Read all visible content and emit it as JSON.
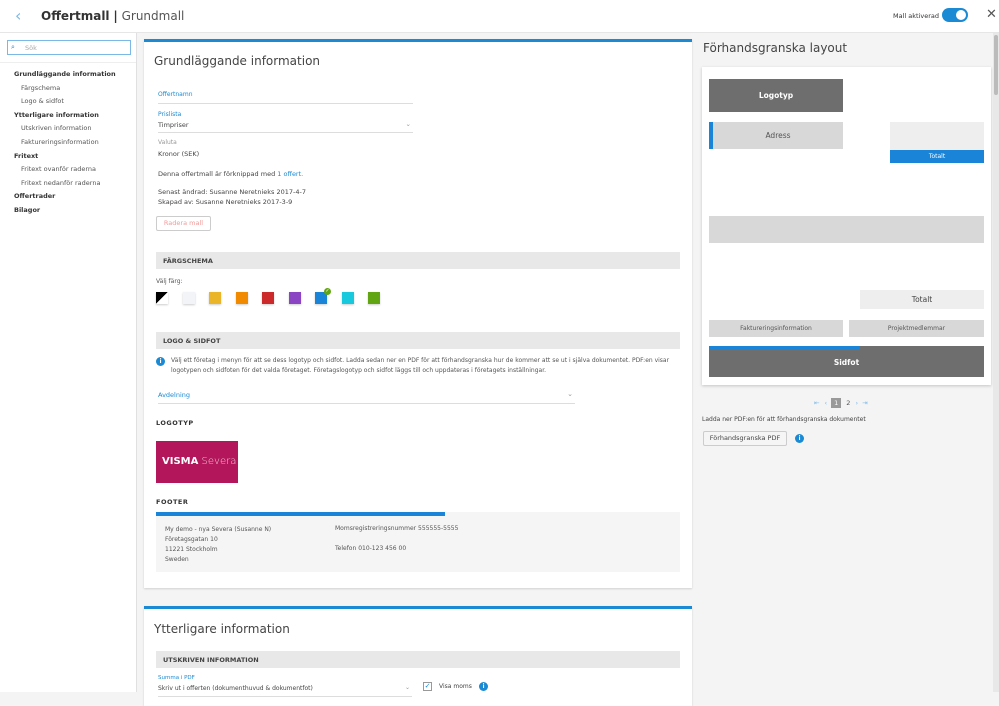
{
  "header": {
    "title_bold": "Offertmall",
    "separator": "|",
    "title_light": "Grundmall",
    "toggle_label": "Mall aktiverad",
    "toggle_on": true
  },
  "sidebar": {
    "search_placeholder": "Sök",
    "items": [
      {
        "label": "Grundläggande information",
        "level": "top"
      },
      {
        "label": "Färgschema",
        "level": "sub"
      },
      {
        "label": "Logo & sidfot",
        "level": "sub"
      },
      {
        "label": "Ytterligare information",
        "level": "top"
      },
      {
        "label": "Utskriven information",
        "level": "sub"
      },
      {
        "label": "Faktureringsinformation",
        "level": "sub"
      },
      {
        "label": "Fritext",
        "level": "top"
      },
      {
        "label": "Fritext ovanför raderna",
        "level": "sub"
      },
      {
        "label": "Fritext nedanför raderna",
        "level": "sub"
      },
      {
        "label": "Offertrader",
        "level": "top"
      },
      {
        "label": "Bilagor",
        "level": "top"
      }
    ]
  },
  "basic": {
    "title": "Grundläggande information",
    "name_label": "Offertnamn",
    "pricelist_label": "Prislista",
    "pricelist_value": "Timpriser",
    "currency_label": "Valuta",
    "currency_value": "Kronor (SEK)",
    "linked_prefix": "Denna offertmall är förknippad med",
    "linked_link": "1 offert.",
    "modified": "Senast ändrad: Susanne Neretnieks 2017-4-7",
    "created": "Skapad av: Susanne Neretnieks 2017-3-9",
    "delete_button": "Radera mall"
  },
  "colors": {
    "section": "FÄRGSCHEMA",
    "choose_label": "Välj färg:",
    "swatches": [
      "#000000",
      "#f2f4f7",
      "#eab528",
      "#f28a00",
      "#cc2a2a",
      "#8b44c4",
      "#1a84d8",
      "#18c8dc",
      "#62a512"
    ],
    "selected_index": 6
  },
  "logo": {
    "section": "LOGO & SIDFOT",
    "info": "Välj ett företag i menyn för att se dess logotyp och sidfot. Ladda sedan ner en PDF för att förhandsgranska hur de kommer att se ut i själva dokumentet. PDF:en visar logotypen och sidfoten för det valda företaget. Företagslogotyp och sidfot läggs till och uppdateras i företagets inställningar.",
    "department_label": "Avdelning",
    "logotype_heading": "LOGOTYP",
    "logo_text_bold": "VISMA",
    "logo_text_light": "Severa",
    "logo_bg": "#b3165a",
    "footer_heading": "FOOTER",
    "footer_left": [
      "My demo - nya Severa (Susanne N)",
      "Företagsgatan 10",
      "11221 Stockholm",
      "Sweden"
    ],
    "footer_vat": "Momsregistreringsnummer 555555-5555",
    "footer_phone": "Telefon 010-123 456 00"
  },
  "additional": {
    "title": "Ytterligare information",
    "section": "UTSKRIVEN INFORMATION",
    "sum_label": "Summa i PDF",
    "sum_value": "Skriv ut i offerten (dokumenthuvud & dokumentfot)",
    "show_vat_label": "Visa moms",
    "show_vat_checked": true
  },
  "preview": {
    "title": "Förhandsgranska layout",
    "logotype": "Logotyp",
    "address": "Adress",
    "total_small": "Totalt",
    "total": "Totalt",
    "invoicing": "Faktureringsinformation",
    "project_members": "Projektmedlemmar",
    "footer": "Sidfot",
    "pages": [
      "1",
      "2"
    ],
    "current_page": "1",
    "download_text": "Ladda ner PDF:en för att förhandsgranska dokumentet",
    "preview_button": "Förhandsgranska PDF"
  },
  "accent": "#1a8ad4"
}
